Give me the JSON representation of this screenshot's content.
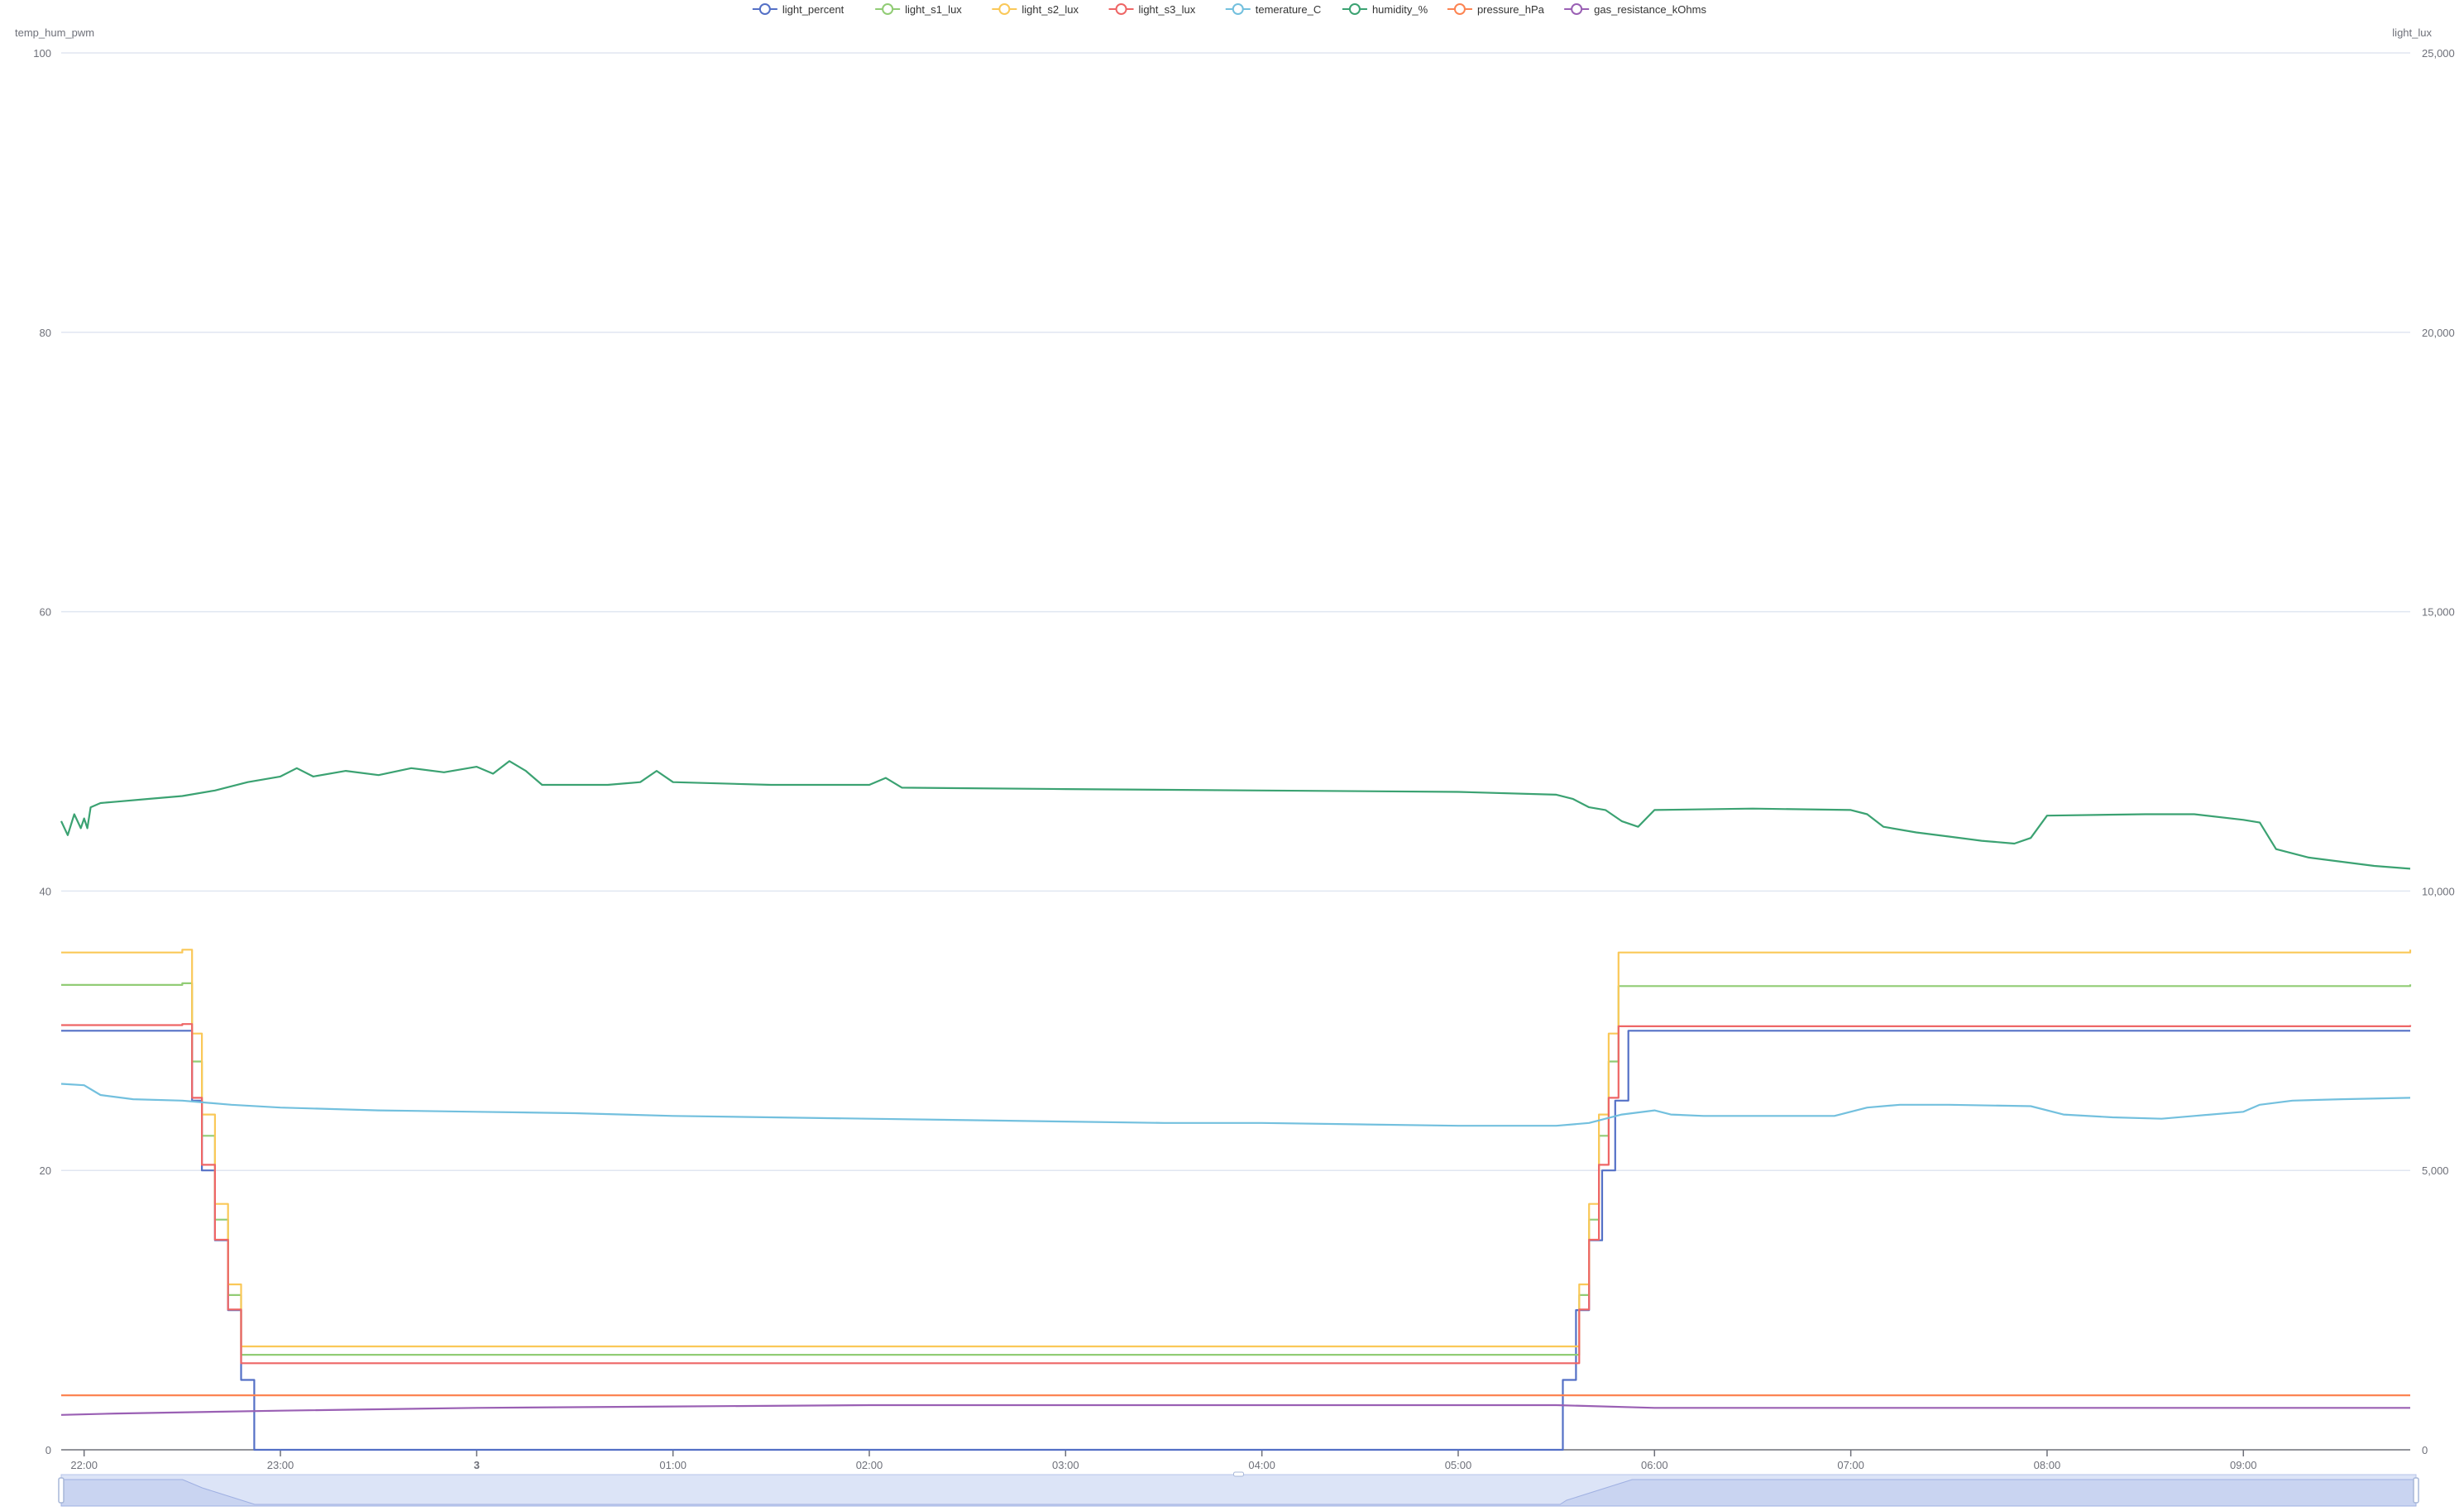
{
  "chart_data": {
    "type": "line",
    "legend_position": "top-center",
    "grid": true,
    "y_left": {
      "name": "temp_hum_pwm",
      "min": 0,
      "max": 100,
      "ticks": [
        "0",
        "20",
        "40",
        "60",
        "80",
        "100"
      ]
    },
    "y_right": {
      "name": "light_lux",
      "min": 0,
      "max": 25000,
      "ticks": [
        "0",
        "5,000",
        "10,000",
        "15,000",
        "20,000",
        "25,000"
      ]
    },
    "x": {
      "start": "21:53",
      "end": "09:51",
      "ticks": [
        {
          "label": "22:00",
          "time": "22:00"
        },
        {
          "label": "23:00",
          "time": "23:00"
        },
        {
          "label": "3",
          "time": "00:00"
        },
        {
          "label": "01:00",
          "time": "01:00"
        },
        {
          "label": "02:00",
          "time": "02:00"
        },
        {
          "label": "03:00",
          "time": "03:00"
        },
        {
          "label": "04:00",
          "time": "04:00"
        },
        {
          "label": "05:00",
          "time": "05:00"
        },
        {
          "label": "06:00",
          "time": "06:00"
        },
        {
          "label": "07:00",
          "time": "07:00"
        },
        {
          "label": "08:00",
          "time": "08:00"
        },
        {
          "label": "09:00",
          "time": "09:00"
        }
      ]
    },
    "series": [
      {
        "name": "light_percent",
        "color": "#5470c6",
        "axis": "left",
        "step": true,
        "points": [
          [
            "21:53",
            30
          ],
          [
            "22:30",
            30
          ],
          [
            "22:33",
            25
          ],
          [
            "22:36",
            20
          ],
          [
            "22:40",
            15
          ],
          [
            "22:44",
            10
          ],
          [
            "22:48",
            5
          ],
          [
            "22:52",
            0
          ],
          [
            "05:30",
            0
          ],
          [
            "05:32",
            5
          ],
          [
            "05:36",
            10
          ],
          [
            "05:40",
            15
          ],
          [
            "05:44",
            20
          ],
          [
            "05:48",
            25
          ],
          [
            "05:52",
            30
          ],
          [
            "09:51",
            30
          ]
        ]
      },
      {
        "name": "light_s1_lux",
        "color": "#91cc75",
        "axis": "right",
        "step": true,
        "points": [
          [
            "21:53",
            8320
          ],
          [
            "22:30",
            8350
          ],
          [
            "22:33",
            6950
          ],
          [
            "22:36",
            5620
          ],
          [
            "22:40",
            4120
          ],
          [
            "22:44",
            2770
          ],
          [
            "22:48",
            1700
          ],
          [
            "05:35",
            1700
          ],
          [
            "05:37",
            2770
          ],
          [
            "05:40",
            4120
          ],
          [
            "05:43",
            5620
          ],
          [
            "05:46",
            6950
          ],
          [
            "05:49",
            8300
          ],
          [
            "09:51",
            8330
          ]
        ]
      },
      {
        "name": "light_s2_lux",
        "color": "#fac858",
        "axis": "right",
        "step": true,
        "points": [
          [
            "21:53",
            8900
          ],
          [
            "22:30",
            8950
          ],
          [
            "22:33",
            7450
          ],
          [
            "22:36",
            6000
          ],
          [
            "22:40",
            4400
          ],
          [
            "22:44",
            2960
          ],
          [
            "22:48",
            1850
          ],
          [
            "05:35",
            1850
          ],
          [
            "05:37",
            2960
          ],
          [
            "05:40",
            4400
          ],
          [
            "05:43",
            6000
          ],
          [
            "05:46",
            7450
          ],
          [
            "05:49",
            8900
          ],
          [
            "09:51",
            8950
          ]
        ]
      },
      {
        "name": "light_s3_lux",
        "color": "#ee6666",
        "axis": "right",
        "step": true,
        "points": [
          [
            "21:53",
            7600
          ],
          [
            "22:30",
            7620
          ],
          [
            "22:33",
            6300
          ],
          [
            "22:36",
            5100
          ],
          [
            "22:40",
            3760
          ],
          [
            "22:44",
            2510
          ],
          [
            "22:48",
            1550
          ],
          [
            "05:35",
            1550
          ],
          [
            "05:37",
            2510
          ],
          [
            "05:40",
            3760
          ],
          [
            "05:43",
            5100
          ],
          [
            "05:46",
            6300
          ],
          [
            "05:49",
            7580
          ],
          [
            "09:51",
            7600
          ]
        ]
      },
      {
        "name": "temerature_C",
        "color": "#73c0de",
        "axis": "left",
        "points": [
          [
            "21:53",
            26.2
          ],
          [
            "22:00",
            26.1
          ],
          [
            "22:05",
            25.4
          ],
          [
            "22:15",
            25.1
          ],
          [
            "22:30",
            25.0
          ],
          [
            "22:45",
            24.7
          ],
          [
            "23:00",
            24.5
          ],
          [
            "23:30",
            24.3
          ],
          [
            "00:00",
            24.2
          ],
          [
            "00:30",
            24.1
          ],
          [
            "01:00",
            23.9
          ],
          [
            "01:30",
            23.8
          ],
          [
            "02:00",
            23.7
          ],
          [
            "02:30",
            23.6
          ],
          [
            "03:00",
            23.5
          ],
          [
            "03:30",
            23.4
          ],
          [
            "04:00",
            23.4
          ],
          [
            "04:30",
            23.3
          ],
          [
            "05:00",
            23.2
          ],
          [
            "05:30",
            23.2
          ],
          [
            "05:40",
            23.4
          ],
          [
            "05:50",
            24.0
          ],
          [
            "06:00",
            24.3
          ],
          [
            "06:05",
            24.0
          ],
          [
            "06:15",
            23.9
          ],
          [
            "06:30",
            23.9
          ],
          [
            "06:55",
            23.9
          ],
          [
            "07:05",
            24.5
          ],
          [
            "07:15",
            24.7
          ],
          [
            "07:30",
            24.7
          ],
          [
            "07:55",
            24.6
          ],
          [
            "08:05",
            24.0
          ],
          [
            "08:20",
            23.8
          ],
          [
            "08:35",
            23.7
          ],
          [
            "08:45",
            23.9
          ],
          [
            "09:00",
            24.2
          ],
          [
            "09:05",
            24.7
          ],
          [
            "09:15",
            25.0
          ],
          [
            "09:30",
            25.1
          ],
          [
            "09:51",
            25.2
          ]
        ]
      },
      {
        "name": "humidity_%",
        "color": "#3ba272",
        "axis": "left",
        "points": [
          [
            "21:53",
            45.0
          ],
          [
            "21:55",
            44.0
          ],
          [
            "21:57",
            45.5
          ],
          [
            "21:59",
            44.5
          ],
          [
            "22:00",
            45.2
          ],
          [
            "22:01",
            44.5
          ],
          [
            "22:02",
            46.0
          ],
          [
            "22:05",
            46.3
          ],
          [
            "22:10",
            46.4
          ],
          [
            "22:20",
            46.6
          ],
          [
            "22:30",
            46.8
          ],
          [
            "22:40",
            47.2
          ],
          [
            "22:50",
            47.8
          ],
          [
            "23:00",
            48.2
          ],
          [
            "23:05",
            48.8
          ],
          [
            "23:10",
            48.2
          ],
          [
            "23:20",
            48.6
          ],
          [
            "23:30",
            48.3
          ],
          [
            "23:40",
            48.8
          ],
          [
            "23:50",
            48.5
          ],
          [
            "00:00",
            48.9
          ],
          [
            "00:05",
            48.4
          ],
          [
            "00:10",
            49.3
          ],
          [
            "00:15",
            48.6
          ],
          [
            "00:20",
            47.6
          ],
          [
            "00:40",
            47.6
          ],
          [
            "00:50",
            47.8
          ],
          [
            "00:55",
            48.6
          ],
          [
            "01:00",
            47.8
          ],
          [
            "01:30",
            47.6
          ],
          [
            "02:00",
            47.6
          ],
          [
            "02:05",
            48.1
          ],
          [
            "02:10",
            47.4
          ],
          [
            "03:00",
            47.3
          ],
          [
            "04:00",
            47.2
          ],
          [
            "05:00",
            47.1
          ],
          [
            "05:30",
            46.9
          ],
          [
            "05:35",
            46.6
          ],
          [
            "05:40",
            46.0
          ],
          [
            "05:45",
            45.8
          ],
          [
            "05:50",
            45.0
          ],
          [
            "05:55",
            44.6
          ],
          [
            "06:00",
            45.8
          ],
          [
            "06:30",
            45.9
          ],
          [
            "07:00",
            45.8
          ],
          [
            "07:05",
            45.5
          ],
          [
            "07:10",
            44.6
          ],
          [
            "07:20",
            44.2
          ],
          [
            "07:30",
            43.9
          ],
          [
            "07:40",
            43.6
          ],
          [
            "07:50",
            43.4
          ],
          [
            "07:55",
            43.8
          ],
          [
            "08:00",
            45.4
          ],
          [
            "08:30",
            45.5
          ],
          [
            "08:45",
            45.5
          ],
          [
            "09:00",
            45.1
          ],
          [
            "09:05",
            44.9
          ],
          [
            "09:10",
            43.0
          ],
          [
            "09:20",
            42.4
          ],
          [
            "09:40",
            41.8
          ],
          [
            "09:51",
            41.6
          ]
        ]
      },
      {
        "name": "pressure_hPa",
        "color": "#fc8452",
        "axis": "left",
        "points": [
          [
            "21:53",
            3.9
          ],
          [
            "09:51",
            3.9
          ]
        ]
      },
      {
        "name": "gas_resistance_kOhms",
        "color": "#9a60b4",
        "axis": "left",
        "points": [
          [
            "21:53",
            2.5
          ],
          [
            "22:10",
            2.6
          ],
          [
            "23:00",
            2.8
          ],
          [
            "00:00",
            3.0
          ],
          [
            "01:00",
            3.1
          ],
          [
            "02:00",
            3.2
          ],
          [
            "03:00",
            3.2
          ],
          [
            "04:00",
            3.2
          ],
          [
            "05:00",
            3.2
          ],
          [
            "05:30",
            3.2
          ],
          [
            "06:00",
            3.0
          ],
          [
            "07:00",
            3.0
          ],
          [
            "08:00",
            3.0
          ],
          [
            "09:00",
            3.0
          ],
          [
            "09:51",
            3.0
          ]
        ]
      }
    ]
  }
}
